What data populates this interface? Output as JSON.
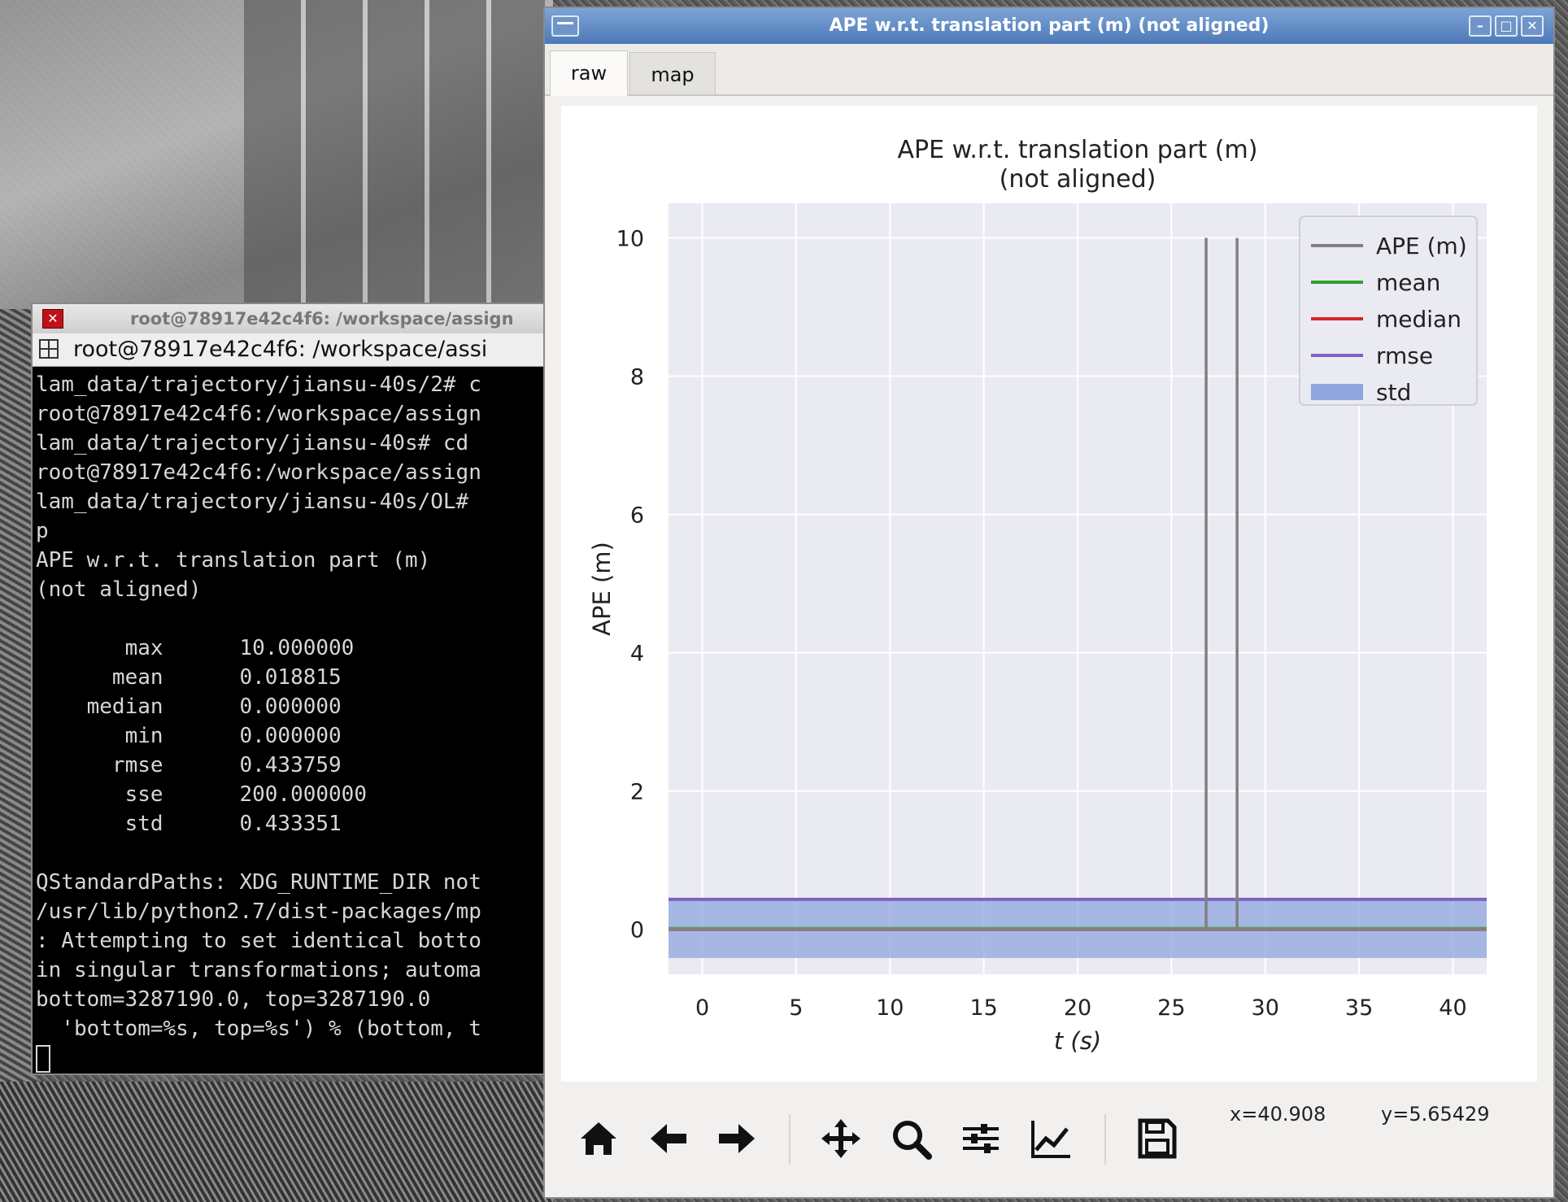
{
  "terminal": {
    "title": "root@78917e42c4f6: /workspace/assign",
    "tab_label": "root@78917e42c4f6: /workspace/assi",
    "close_glyph": "✕",
    "lines": [
      "lam_data/trajectory/jiansu-40s/2# c",
      "root@78917e42c4f6:/workspace/assign",
      "lam_data/trajectory/jiansu-40s# cd ",
      "root@78917e42c4f6:/workspace/assign",
      "lam_data/trajectory/jiansu-40s/OL# ",
      "p",
      "APE w.r.t. translation part (m)",
      "(not aligned)",
      "",
      "       max      10.000000",
      "      mean      0.018815",
      "    median      0.000000",
      "       min      0.000000",
      "      rmse      0.433759",
      "       sse      200.000000",
      "       std      0.433351",
      "",
      "QStandardPaths: XDG_RUNTIME_DIR not",
      "/usr/lib/python2.7/dist-packages/mp",
      ": Attempting to set identical botto",
      "in singular transformations; automa",
      "bottom=3287190.0, top=3287190.0",
      "  'bottom=%s, top=%s') % (bottom, t"
    ]
  },
  "plot_window": {
    "title": "APE w.r.t. translation part (m) (not aligned)",
    "min_glyph": "–",
    "max_glyph": "□",
    "close_glyph": "✕",
    "tabs": [
      {
        "label": "raw",
        "active": true
      },
      {
        "label": "map",
        "active": false
      }
    ],
    "toolbar": {
      "icons": [
        "home-icon",
        "back-arrow-icon",
        "forward-arrow-icon",
        "pan-move-icon",
        "zoom-magnifier-icon",
        "configure-subplots-icon",
        "edit-axis-icon",
        "save-disk-icon"
      ],
      "coord_x": "x=40.908",
      "coord_y": "y=5.65429"
    }
  },
  "chart_data": {
    "type": "line",
    "title": "APE w.r.t. translation part (m)\n(not aligned)",
    "title_lines": [
      "APE w.r.t. translation part (m)",
      "(not aligned)"
    ],
    "xlabel": "t (s)",
    "ylabel": "APE (m)",
    "xlim": [
      -1.8,
      41.8
    ],
    "ylim": [
      -0.65,
      10.5
    ],
    "xticks": [
      0,
      5,
      10,
      15,
      20,
      25,
      30,
      35,
      40
    ],
    "yticks": [
      0,
      2,
      4,
      6,
      8,
      10
    ],
    "grid": true,
    "legend": "top-right",
    "series": [
      {
        "name": "APE (m)",
        "color": "#808080",
        "x": [
          -1.8,
          26.85,
          26.85,
          26.85,
          28.5,
          28.5,
          28.5,
          41.8
        ],
        "y": [
          0,
          0,
          10,
          0,
          0,
          10,
          0,
          0
        ]
      },
      {
        "name": "mean",
        "color": "#2ca02c",
        "value": 0.018815
      },
      {
        "name": "median",
        "color": "#d62728",
        "value": 0.0
      },
      {
        "name": "rmse",
        "color": "#7f63c0",
        "value": 0.433759
      },
      {
        "name": "std",
        "color": "#8fa6dd",
        "band": [
          -0.414536,
          0.452166
        ]
      }
    ]
  }
}
